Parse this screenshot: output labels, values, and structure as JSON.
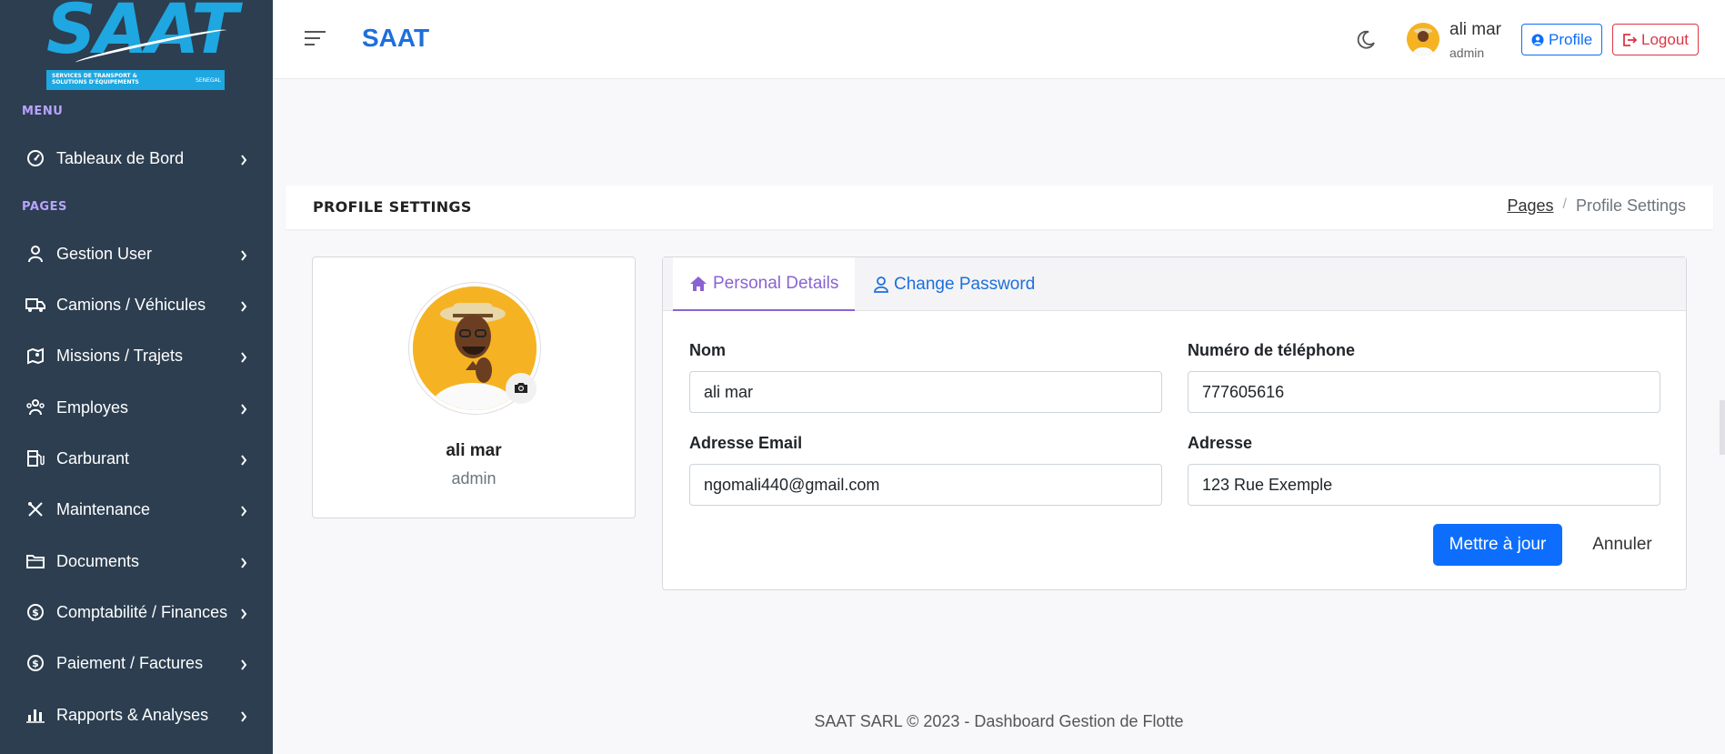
{
  "sidebar": {
    "logo": {
      "text": "SAAT",
      "subtitle": "SERVICES DE TRANSPORT & SOLUTIONS D'ÉQUIPEMENTS",
      "country": "SENEGAL"
    },
    "menu_title": "MENU",
    "pages_title": "PAGES",
    "items": [
      {
        "label": "Tableaux de Bord",
        "icon": "dashboard-gauge-icon"
      },
      {
        "label": "Gestion User",
        "icon": "user-icon"
      },
      {
        "label": "Camions / Véhicules",
        "icon": "truck-icon"
      },
      {
        "label": "Missions / Trajets",
        "icon": "map-pin-icon"
      },
      {
        "label": "Employes",
        "icon": "people-icon"
      },
      {
        "label": "Carburant",
        "icon": "fuel-icon"
      },
      {
        "label": "Maintenance",
        "icon": "tools-icon"
      },
      {
        "label": "Documents",
        "icon": "folder-icon"
      },
      {
        "label": "Comptabilité / Finances",
        "icon": "dollar-circle-icon"
      },
      {
        "label": "Paiement / Factures",
        "icon": "dollar-circle-icon"
      },
      {
        "label": "Rapports & Analyses",
        "icon": "bar-chart-icon"
      }
    ]
  },
  "header": {
    "brand": "SAAT",
    "user_name": "ali mar",
    "user_role": "admin",
    "profile_btn": "Profile",
    "logout_btn": "Logout"
  },
  "page": {
    "title": "PROFILE SETTINGS",
    "breadcrumb": [
      "Pages",
      "Profile Settings"
    ]
  },
  "profile_card": {
    "name": "ali mar",
    "role": "admin"
  },
  "form": {
    "tabs": [
      {
        "label": "Personal Details",
        "active": true
      },
      {
        "label": "Change Password",
        "active": false
      }
    ],
    "fields": {
      "nom": {
        "label": "Nom",
        "value": "ali mar"
      },
      "telephone": {
        "label": "Numéro de téléphone",
        "value": "777605616"
      },
      "email": {
        "label": "Adresse Email",
        "value": "ngomali440@gmail.com"
      },
      "adresse": {
        "label": "Adresse",
        "value": "123 Rue Exemple"
      }
    },
    "submit": "Mettre à jour",
    "cancel": "Annuler"
  },
  "footer": "SAAT SARL © 2023 - Dashboard Gestion de Flotte",
  "colors": {
    "sidebar": "#2c3e50",
    "primary": "#0d6efd",
    "accent": "#8a63d2",
    "danger": "#dc3545",
    "logo": "#1ea7e1"
  }
}
